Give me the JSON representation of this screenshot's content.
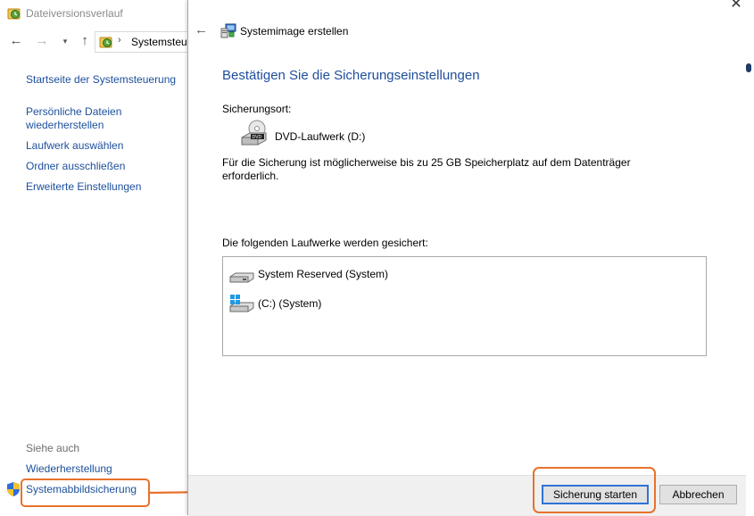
{
  "background_window": {
    "title": "Dateiversionsverlauf",
    "title_icon": "file-history-icon",
    "nav": {
      "back_icon": "back-arrow-icon",
      "forward_icon": "forward-arrow-icon",
      "recent_icon": "chevron-down-icon",
      "up_icon": "up-arrow-icon"
    },
    "address": {
      "icon": "file-history-icon",
      "separator": "›",
      "text": "Systemsteu"
    },
    "sidebar": {
      "links": [
        "Startseite der Systemsteuerung",
        "Persönliche Dateien wiederherstellen",
        "Laufwerk auswählen",
        "Ordner ausschließen",
        "Erweiterte Einstellungen"
      ],
      "see_also_heading": "Siehe auch",
      "see_also_links": [
        "Wiederherstellung",
        "Systemabbildsicherung"
      ],
      "shield_icon": "uac-shield-icon"
    }
  },
  "dialog": {
    "title": "Systemimage erstellen",
    "title_icon": "system-image-icon",
    "back_icon": "back-arrow-icon",
    "close_glyph": "✕",
    "heading": "Bestätigen Sie die Sicherungseinstellungen",
    "location_label": "Sicherungsort:",
    "location_value": "DVD-Laufwerk (D:)",
    "location_icon": "dvd-drive-icon",
    "note": "Für die Sicherung ist möglicherweise bis zu 25 GB Speicherplatz auf dem Datenträger erforderlich.",
    "list_label": "Die folgenden Laufwerke werden gesichert:",
    "drives": [
      {
        "label": "System Reserved (System)",
        "icon": "hard-drive-icon"
      },
      {
        "label": "(C:) (System)",
        "icon": "windows-drive-icon"
      }
    ],
    "buttons": {
      "start": "Sicherung starten",
      "cancel": "Abbrechen"
    }
  },
  "annotations": {
    "highlight_color": "#e8722c",
    "arrow_icon": "arrow-right-icon"
  },
  "colors": {
    "link": "#1c4f9c",
    "heading": "#1f4e9b",
    "default_button_border": "#2f73d6"
  }
}
